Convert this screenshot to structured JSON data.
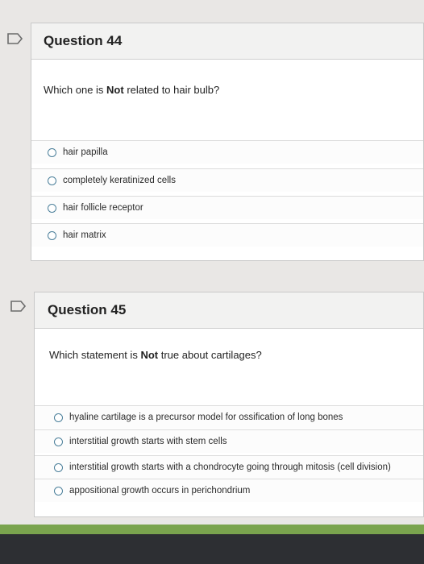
{
  "questions": [
    {
      "title": "Question 44",
      "prompt_pre": "Which one is ",
      "prompt_bold": "Not",
      "prompt_post": " related to hair bulb?",
      "choices": [
        "hair papilla",
        "completely keratinized cells",
        "hair follicle receptor",
        "hair matrix"
      ]
    },
    {
      "title": "Question 45",
      "prompt_pre": "Which statement is ",
      "prompt_bold": "Not",
      "prompt_post": " true about cartilages?",
      "choices": [
        "hyaline cartilage is a precursor model for ossification of long bones",
        "interstitial growth starts with stem cells",
        "interstitial growth starts with a chondrocyte going through mitosis (cell division)",
        "appositional growth occurs in perichondrium"
      ]
    }
  ],
  "colors": {
    "accent": "#4b7f9a",
    "green_bar": "#7aa44e",
    "dark_bar": "#2d2f33"
  },
  "icons": {
    "flag": "flag-icon",
    "radio": "radio-button-icon"
  }
}
